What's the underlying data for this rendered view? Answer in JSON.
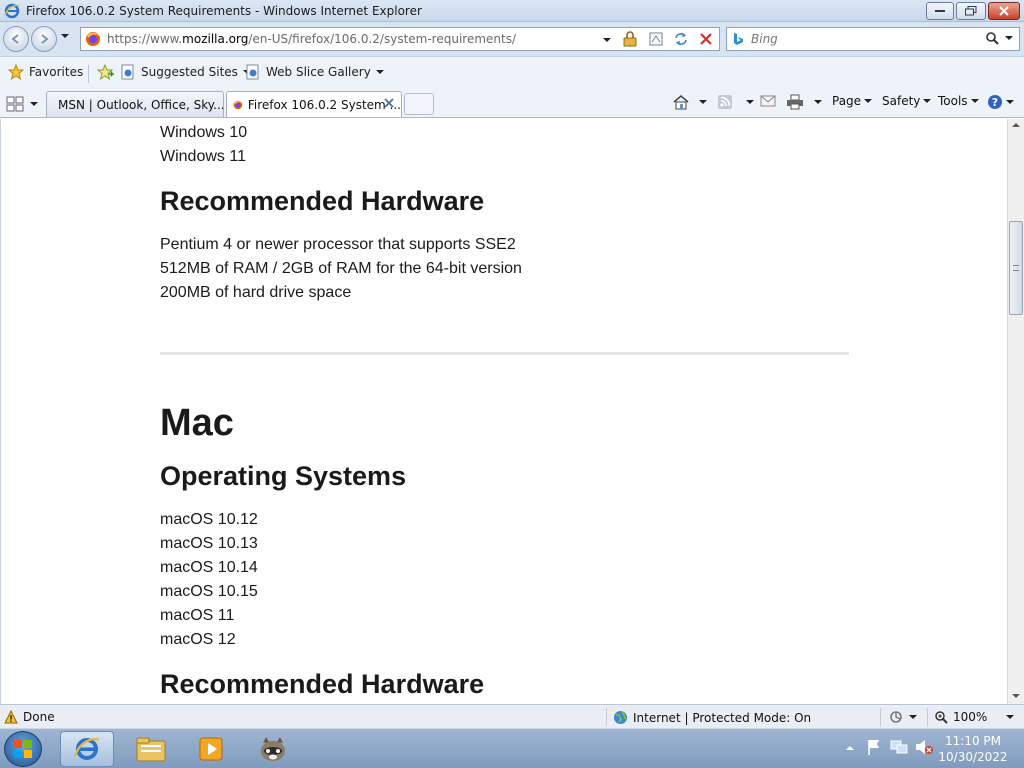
{
  "window": {
    "title": "Firefox 106.0.2 System Requirements - Windows Internet Explorer"
  },
  "address_bar": {
    "url_prefix": "https://www.",
    "url_domain": "mozilla.org",
    "url_path": "/en-US/firefox/106.0.2/system-requirements/"
  },
  "search": {
    "placeholder": "Bing"
  },
  "favorites_bar": {
    "favorites_label": "Favorites",
    "suggested_sites": "Suggested Sites",
    "web_slice_gallery": "Web Slice Gallery"
  },
  "tabs": [
    {
      "label": "MSN | Outlook, Office, Sky..."
    },
    {
      "label": "Firefox 106.0.2 System ..."
    }
  ],
  "command_bar": {
    "page": "Page",
    "safety": "Safety",
    "tools": "Tools"
  },
  "content": {
    "windows_os": [
      "Windows 10",
      "Windows 11"
    ],
    "recommended_hardware_heading_1": "Recommended Hardware",
    "hardware_items": [
      "Pentium 4 or newer processor that supports SSE2",
      "512MB of RAM / 2GB of RAM for the 64-bit version",
      "200MB of hard drive space"
    ],
    "mac_heading": "Mac",
    "operating_systems_heading": "Operating Systems",
    "mac_os": [
      "macOS 10.12",
      "macOS 10.13",
      "macOS 10.14",
      "macOS 10.15",
      "macOS 11",
      "macOS 12"
    ],
    "recommended_hardware_heading_2": "Recommended Hardware"
  },
  "status_bar": {
    "status": "Done",
    "zone": "Internet | Protected Mode: On",
    "zoom": "100%"
  },
  "taskbar": {
    "time": "11:10 PM",
    "date": "10/30/2022"
  },
  "icons": [
    "ie-icon",
    "back-icon",
    "forward-icon",
    "firefox-favicon",
    "lock-icon",
    "compat-view-icon",
    "refresh-icon",
    "stop-icon",
    "bing-icon",
    "search-icon",
    "favorites-star-icon",
    "add-favorites-icon",
    "quick-tabs-icon",
    "home-icon",
    "rss-icon",
    "mail-icon",
    "print-icon",
    "help-icon",
    "warning-icon",
    "globe-icon",
    "zoom-icon",
    "start-orb",
    "explorer-icon",
    "media-player-icon",
    "raccoon-icon",
    "flag-icon",
    "network-icon",
    "volume-muted-icon"
  ]
}
